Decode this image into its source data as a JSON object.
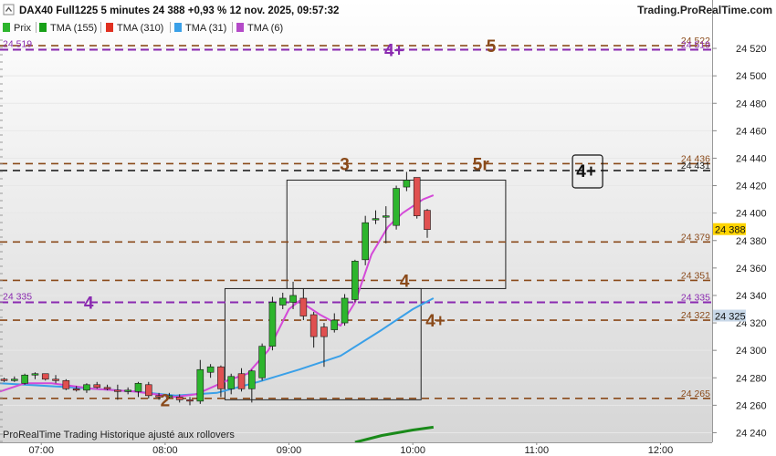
{
  "header": {
    "title": "DAX40 Full1225 5 minutes 24 388 +0,93 % 12 nov. 2025, 09:57:32",
    "source": "Trading.ProRealTime.com",
    "footer": "ProRealTime Trading  Historique ajusté aux rollovers"
  },
  "legend": [
    {
      "label": "Prix",
      "color": "#2db52d"
    },
    {
      "label": "TMA (155)",
      "color": "#18a018"
    },
    {
      "label": "TMA (310)",
      "color": "#e03020"
    },
    {
      "label": "TMA (31)",
      "color": "#3aa0e8"
    },
    {
      "label": "TMA (6)",
      "color": "#b44ac8"
    }
  ],
  "chart_data": {
    "type": "candlestick",
    "xlim": [
      "06:40",
      "12:25"
    ],
    "ylim": [
      24233,
      24530
    ],
    "x_ticks": [
      "07:00",
      "08:00",
      "09:00",
      "10:00",
      "11:00",
      "12:00"
    ],
    "y_ticks": [
      24240,
      24260,
      24280,
      24300,
      24320,
      24340,
      24360,
      24380,
      24400,
      24420,
      24440,
      24460,
      24480,
      24500,
      24520
    ],
    "candles": [
      {
        "t": "06:42",
        "o": 24279,
        "h": 24280,
        "l": 24277,
        "c": 24278
      },
      {
        "t": "06:47",
        "o": 24278,
        "h": 24281,
        "l": 24277,
        "c": 24279
      },
      {
        "t": "06:52",
        "o": 24276,
        "h": 24283,
        "l": 24275,
        "c": 24282
      },
      {
        "t": "06:57",
        "o": 24282,
        "h": 24284,
        "l": 24279,
        "c": 24283
      },
      {
        "t": "07:02",
        "o": 24283,
        "h": 24283,
        "l": 24278,
        "c": 24279
      },
      {
        "t": "07:07",
        "o": 24279,
        "h": 24282,
        "l": 24276,
        "c": 24278
      },
      {
        "t": "07:12",
        "o": 24278,
        "h": 24279,
        "l": 24271,
        "c": 24272
      },
      {
        "t": "07:17",
        "o": 24272,
        "h": 24274,
        "l": 24270,
        "c": 24271
      },
      {
        "t": "07:22",
        "o": 24271,
        "h": 24276,
        "l": 24269,
        "c": 24275
      },
      {
        "t": "07:27",
        "o": 24275,
        "h": 24277,
        "l": 24272,
        "c": 24273
      },
      {
        "t": "07:32",
        "o": 24273,
        "h": 24275,
        "l": 24271,
        "c": 24272
      },
      {
        "t": "07:37",
        "o": 24271,
        "h": 24275,
        "l": 24264,
        "c": 24270
      },
      {
        "t": "07:42",
        "o": 24270,
        "h": 24273,
        "l": 24268,
        "c": 24271
      },
      {
        "t": "07:47",
        "o": 24270,
        "h": 24277,
        "l": 24266,
        "c": 24276
      },
      {
        "t": "07:52",
        "o": 24275,
        "h": 24277,
        "l": 24265,
        "c": 24267
      },
      {
        "t": "07:57",
        "o": 24267,
        "h": 24269,
        "l": 24264,
        "c": 24266
      },
      {
        "t": "08:02",
        "o": 24266,
        "h": 24269,
        "l": 24265,
        "c": 24267
      },
      {
        "t": "08:07",
        "o": 24266,
        "h": 24268,
        "l": 24262,
        "c": 24264
      },
      {
        "t": "08:12",
        "o": 24264,
        "h": 24266,
        "l": 24260,
        "c": 24263
      },
      {
        "t": "08:17",
        "o": 24263,
        "h": 24293,
        "l": 24261,
        "c": 24286
      },
      {
        "t": "08:22",
        "o": 24284,
        "h": 24290,
        "l": 24280,
        "c": 24288
      },
      {
        "t": "08:27",
        "o": 24288,
        "h": 24289,
        "l": 24266,
        "c": 24272
      },
      {
        "t": "08:32",
        "o": 24272,
        "h": 24283,
        "l": 24268,
        "c": 24281
      },
      {
        "t": "08:37",
        "o": 24283,
        "h": 24287,
        "l": 24270,
        "c": 24272
      },
      {
        "t": "08:42",
        "o": 24272,
        "h": 24286,
        "l": 24262,
        "c": 24285
      },
      {
        "t": "08:47",
        "o": 24280,
        "h": 24305,
        "l": 24278,
        "c": 24303
      },
      {
        "t": "08:52",
        "o": 24303,
        "h": 24339,
        "l": 24300,
        "c": 24335
      },
      {
        "t": "08:57",
        "o": 24333,
        "h": 24342,
        "l": 24330,
        "c": 24338
      },
      {
        "t": "09:02",
        "o": 24335,
        "h": 24350,
        "l": 24330,
        "c": 24340
      },
      {
        "t": "09:07",
        "o": 24338,
        "h": 24345,
        "l": 24322,
        "c": 24325
      },
      {
        "t": "09:12",
        "o": 24326,
        "h": 24328,
        "l": 24302,
        "c": 24310
      },
      {
        "t": "09:17",
        "o": 24317,
        "h": 24320,
        "l": 24288,
        "c": 24310
      },
      {
        "t": "09:22",
        "o": 24315,
        "h": 24327,
        "l": 24313,
        "c": 24322
      },
      {
        "t": "09:27",
        "o": 24320,
        "h": 24341,
        "l": 24318,
        "c": 24338
      },
      {
        "t": "09:32",
        "o": 24337,
        "h": 24366,
        "l": 24335,
        "c": 24365
      },
      {
        "t": "09:37",
        "o": 24366,
        "h": 24398,
        "l": 24362,
        "c": 24393
      },
      {
        "t": "09:42",
        "o": 24395,
        "h": 24402,
        "l": 24392,
        "c": 24396
      },
      {
        "t": "09:47",
        "o": 24397,
        "h": 24405,
        "l": 24378,
        "c": 24398
      },
      {
        "t": "09:52",
        "o": 24391,
        "h": 24420,
        "l": 24388,
        "c": 24418
      },
      {
        "t": "09:57",
        "o": 24419,
        "h": 24430,
        "l": 24416,
        "c": 24424
      },
      {
        "t": "10:02",
        "o": 24426,
        "h": 24426,
        "l": 24396,
        "c": 24398
      },
      {
        "t": "10:07",
        "o": 24402,
        "h": 24403,
        "l": 24382,
        "c": 24388
      }
    ],
    "tma6": [
      [
        "06:40",
        24270
      ],
      [
        "06:52",
        24276
      ],
      [
        "07:05",
        24276
      ],
      [
        "07:25",
        24272
      ],
      [
        "07:45",
        24270
      ],
      [
        "08:05",
        24266
      ],
      [
        "08:15",
        24268
      ],
      [
        "08:30",
        24278
      ],
      [
        "08:40",
        24283
      ],
      [
        "08:50",
        24300
      ],
      [
        "09:00",
        24330
      ],
      [
        "09:05",
        24336
      ],
      [
        "09:15",
        24326
      ],
      [
        "09:25",
        24318
      ],
      [
        "09:32",
        24335
      ],
      [
        "09:40",
        24370
      ],
      [
        "09:48",
        24390
      ],
      [
        "09:55",
        24400
      ],
      [
        "10:05",
        24410
      ],
      [
        "10:10",
        24413
      ]
    ],
    "tma31": [
      [
        "06:40",
        24276
      ],
      [
        "07:15",
        24273
      ],
      [
        "07:45",
        24270
      ],
      [
        "08:05",
        24267
      ],
      [
        "08:25",
        24269
      ],
      [
        "08:45",
        24277
      ],
      [
        "09:05",
        24286
      ],
      [
        "09:25",
        24296
      ],
      [
        "09:45",
        24315
      ],
      [
        "10:00",
        24330
      ],
      [
        "10:10",
        24338
      ]
    ],
    "tma155": [
      [
        "09:32",
        24233
      ],
      [
        "09:45",
        24238
      ],
      [
        "10:00",
        24242
      ],
      [
        "10:10",
        24244
      ]
    ],
    "levels": [
      {
        "value": 24522,
        "label": "24 522",
        "color": "#8a4a1a",
        "style": "dashed"
      },
      {
        "value": 24519,
        "label": "24 519",
        "color": "#8a2ab0",
        "style": "dashed"
      },
      {
        "value": 24436,
        "label": "24 436",
        "color": "#8a4a1a",
        "style": "dashed"
      },
      {
        "value": 24431,
        "label": "24 431",
        "color": "#111111",
        "style": "dashed"
      },
      {
        "value": 24379,
        "label": "24 379",
        "color": "#8a4a1a",
        "style": "dashed"
      },
      {
        "value": 24351,
        "label": "24 351",
        "color": "#8a4a1a",
        "style": "dashed"
      },
      {
        "value": 24335,
        "label": "24 335",
        "color": "#8a2ab0",
        "style": "dashed"
      },
      {
        "value": 24322,
        "label": "24 322",
        "color": "#8a4a1a",
        "style": "dashed"
      },
      {
        "value": 24265,
        "label": "24 265",
        "color": "#8a4a1a",
        "style": "dashed"
      }
    ],
    "price_tags": [
      {
        "value": 24388,
        "label": "24 388",
        "color": "#ffd400"
      },
      {
        "value": 24325,
        "label": "24 325",
        "color": "#c8d8e8"
      }
    ],
    "boxes": [
      {
        "t1": "08:29",
        "t2": "10:04",
        "y1": 24264,
        "y2": 24345
      },
      {
        "t1": "08:59",
        "t2": "10:45",
        "y1": 24345,
        "y2": 24424
      }
    ],
    "annotations": [
      {
        "text": "4+",
        "t": "09:51",
        "y": 24519,
        "color": "#8a2ab0"
      },
      {
        "text": "5",
        "t": "10:38",
        "y": 24522,
        "color": "#8a4a1a"
      },
      {
        "text": "3",
        "t": "09:27",
        "y": 24436,
        "color": "#8a4a1a"
      },
      {
        "text": "5r",
        "t": "10:33",
        "y": 24436,
        "color": "#8a4a1a"
      },
      {
        "text": "4+",
        "t": "11:24",
        "y": 24431,
        "color": "#111111",
        "boxed": true
      },
      {
        "text": "4",
        "t": "09:56",
        "y": 24351,
        "color": "#8a4a1a"
      },
      {
        "text": "4",
        "t": "07:23",
        "y": 24335,
        "color": "#8a2ab0"
      },
      {
        "text": "4+",
        "t": "10:11",
        "y": 24322,
        "color": "#8a4a1a"
      },
      {
        "text": "2",
        "t": "08:00",
        "y": 24264,
        "color": "#8a4a1a"
      }
    ]
  }
}
